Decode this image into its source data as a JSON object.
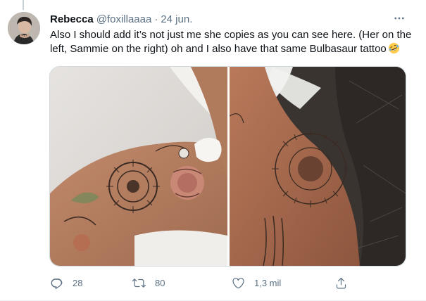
{
  "tweet": {
    "display_name": "Rebecca",
    "handle": "@foxillaaaa",
    "separator": "·",
    "date": "24 jun.",
    "text": "Also I should add it’s not just me she copies as you can see here. (Her on the left, Sammie on the right) oh and I also have that same Bulbasaur tattoo",
    "emoji": "rolling-on-the-floor-laughing-emoji"
  },
  "media": {
    "photos": [
      {
        "icon": "tattooed-thigh-photo-left"
      },
      {
        "icon": "tattooed-leg-photo-right"
      }
    ]
  },
  "actions": {
    "reply_count": "28",
    "retweet_count": "80",
    "like_count": "1,3 mil",
    "icons": [
      "reply-icon",
      "retweet-icon",
      "like-icon",
      "share-icon"
    ]
  },
  "colors": {
    "text": "#0f1419",
    "secondary": "#5b7083",
    "border": "#cfd9de"
  }
}
